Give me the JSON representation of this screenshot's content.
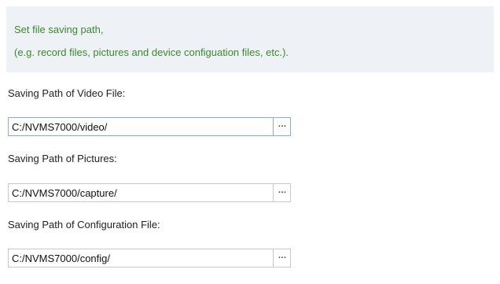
{
  "info": {
    "line1": "Set file saving path,",
    "line2": "(e.g. record files, pictures and device configuation files, etc.)."
  },
  "fields": [
    {
      "label": "Saving Path of Video File:",
      "value": "C:/NVMS7000/video/",
      "browse_icon": "…"
    },
    {
      "label": "Saving Path of Pictures:",
      "value": "C:/NVMS7000/capture/",
      "browse_icon": "…"
    },
    {
      "label": "Saving Path of Configuration File:",
      "value": "C:/NVMS7000/config/",
      "browse_icon": "…"
    }
  ],
  "colors": {
    "info_text": "#3b8a2f",
    "info_background": "#eef1f5",
    "focus_border": "#7fb0df"
  }
}
